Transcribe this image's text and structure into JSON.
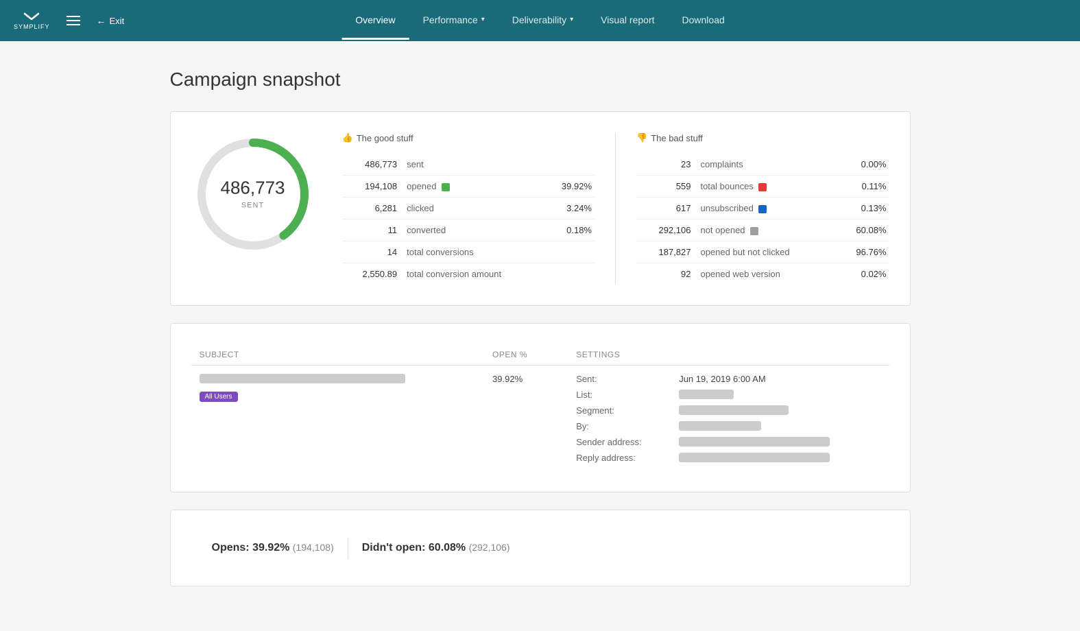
{
  "header": {
    "logo_text": "SYMPLIFY",
    "exit_label": "Exit",
    "nav_items": [
      {
        "id": "overview",
        "label": "Overview",
        "active": true,
        "dropdown": false
      },
      {
        "id": "performance",
        "label": "Performance",
        "active": false,
        "dropdown": true
      },
      {
        "id": "deliverability",
        "label": "Deliverability",
        "active": false,
        "dropdown": true
      },
      {
        "id": "visual_report",
        "label": "Visual report",
        "active": false,
        "dropdown": false
      },
      {
        "id": "download",
        "label": "Download",
        "active": false,
        "dropdown": false
      }
    ]
  },
  "page": {
    "title": "Campaign snapshot"
  },
  "snapshot": {
    "total": "486,773",
    "sent_label": "SENT",
    "good_title": "The good stuff",
    "bad_title": "The bad stuff",
    "good_stats": [
      {
        "num": "486,773",
        "label": "sent",
        "pct": ""
      },
      {
        "num": "194,108",
        "label": "opened",
        "pct": "39.92%",
        "color": "#4caf50"
      },
      {
        "num": "6,281",
        "label": "clicked",
        "pct": "3.24%"
      },
      {
        "num": "11",
        "label": "converted",
        "pct": "0.18%"
      },
      {
        "num": "14",
        "label": "total conversions",
        "pct": ""
      },
      {
        "num": "2,550.89",
        "label": "total conversion amount",
        "pct": ""
      }
    ],
    "bad_stats": [
      {
        "num": "23",
        "label": "complaints",
        "pct": "0.00%"
      },
      {
        "num": "559",
        "label": "total bounces",
        "pct": "0.11%",
        "color": "#e53935"
      },
      {
        "num": "617",
        "label": "unsubscribed",
        "pct": "0.13%",
        "color": "#1565c0"
      },
      {
        "num": "292,106",
        "label": "not opened",
        "pct": "60.08%",
        "color": "#9e9e9e"
      },
      {
        "num": "187,827",
        "label": "opened but not clicked",
        "pct": "96.76%"
      },
      {
        "num": "92",
        "label": "opened web version",
        "pct": "0.02%"
      }
    ],
    "donut": {
      "radius": 75,
      "stroke_width": 12,
      "pct": 39.92,
      "color_filled": "#4caf50",
      "color_empty": "#e0e0e0"
    }
  },
  "campaign_detail": {
    "columns": [
      "Subject",
      "Open %",
      "Settings"
    ],
    "subject_blurred": "████████ ████████ ██████ ███ █████ ███ ███████",
    "open_pct": "39.92%",
    "tag": "All Users",
    "settings": {
      "sent_label": "Sent:",
      "sent_value": "Jun 19, 2019 6:00 AM",
      "list_label": "List:",
      "list_value": "██ █████",
      "segment_label": "Segment:",
      "segment_value": "█████████ ████ █████ █",
      "by_label": "By:",
      "by_value": "████████ ███████",
      "sender_label": "Sender address:",
      "sender_value": "████ █████ ███ ███████████████ ███ ███",
      "reply_label": "Reply address:",
      "reply_value": "████ █████ ███ ███████ ███████████ ███ ███"
    }
  },
  "bottom_bar": {
    "opens_label": "Opens:",
    "opens_pct": "39.92%",
    "opens_count": "(194,108)",
    "didnt_open_label": "Didn't open:",
    "didnt_open_pct": "60.08%",
    "didnt_open_count": "(292,106)"
  }
}
